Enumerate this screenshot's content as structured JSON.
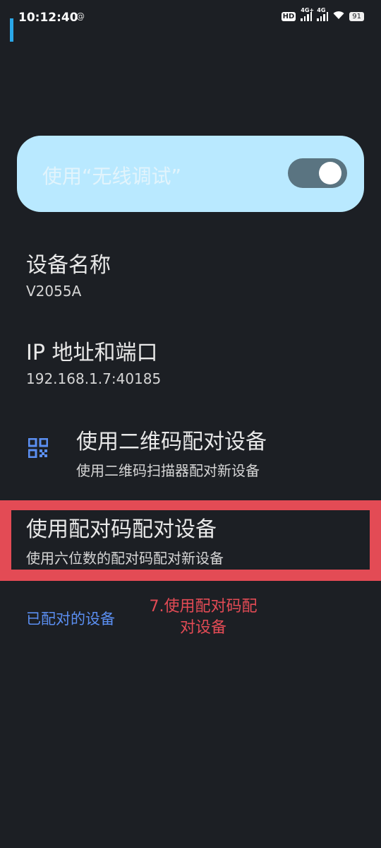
{
  "status_bar": {
    "time": "10:12:40",
    "notification_glyph": "@",
    "hd_label": "HD",
    "sim1_label": "4G+",
    "sim2_label": "4G",
    "battery": "91"
  },
  "toggle": {
    "label": "使用“无线调试”",
    "state": "on"
  },
  "device_name": {
    "title": "设备名称",
    "value": "V2055A"
  },
  "ip_port": {
    "title": "IP 地址和端口",
    "value": "192.168.1.7:40185"
  },
  "qr_pair": {
    "title": "使用二维码配对设备",
    "subtitle": "使用二维码扫描器配对新设备",
    "icon": "qr-code-icon"
  },
  "code_pair": {
    "title": "使用配对码配对设备",
    "subtitle": "使用六位数的配对码配对新设备"
  },
  "paired_devices": {
    "label": "已配对的设备"
  },
  "annotation": {
    "line1": "7.使用配对码配",
    "line2": "对设备"
  },
  "colors": {
    "accent": "#5b8ff2",
    "highlight": "#e34b55",
    "toggle_bg": "#b9e9ff",
    "background": "#1c1f24"
  }
}
